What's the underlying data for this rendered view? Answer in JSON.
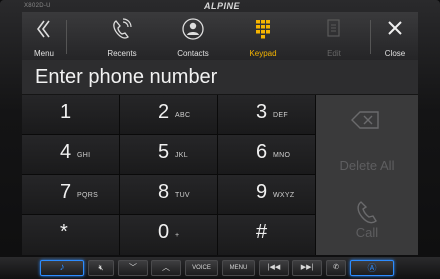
{
  "device": {
    "model": "X802D-U",
    "brand": "ALPINE"
  },
  "topbar": {
    "items": [
      {
        "label": "Menu",
        "icon": "double-chevron-left-icon",
        "state": "normal"
      },
      {
        "label": "Recents",
        "icon": "phone-recents-icon",
        "state": "normal"
      },
      {
        "label": "Contacts",
        "icon": "person-icon",
        "state": "normal"
      },
      {
        "label": "Keypad",
        "icon": "keypad-grid-icon",
        "state": "active"
      },
      {
        "label": "Edit",
        "icon": "document-edit-icon",
        "state": "disabled"
      },
      {
        "label": "Close",
        "icon": "close-icon",
        "state": "normal"
      }
    ]
  },
  "input": {
    "placeholder": "Enter phone number"
  },
  "keypad": {
    "keys": [
      {
        "digit": "1",
        "letters": ""
      },
      {
        "digit": "2",
        "letters": "ABC"
      },
      {
        "digit": "3",
        "letters": "DEF"
      },
      {
        "digit": "4",
        "letters": "GHI"
      },
      {
        "digit": "5",
        "letters": "JKL"
      },
      {
        "digit": "6",
        "letters": "MNO"
      },
      {
        "digit": "7",
        "letters": "PQRS"
      },
      {
        "digit": "8",
        "letters": "TUV"
      },
      {
        "digit": "9",
        "letters": "WXYZ"
      },
      {
        "digit": "*",
        "letters": ""
      },
      {
        "digit": "0",
        "letters": "+"
      },
      {
        "digit": "#",
        "letters": ""
      }
    ]
  },
  "side": {
    "backspace_icon": "backspace-icon",
    "delete_all_label": "Delete All",
    "call_label": "Call",
    "call_icon": "phone-handset-icon",
    "disabled_color": "#5e5e60"
  },
  "hardware": {
    "voice_label": "VOICE",
    "menu_label": "MENU",
    "accent_color": "#2d8cff"
  },
  "colors": {
    "active": "#f5b400"
  }
}
